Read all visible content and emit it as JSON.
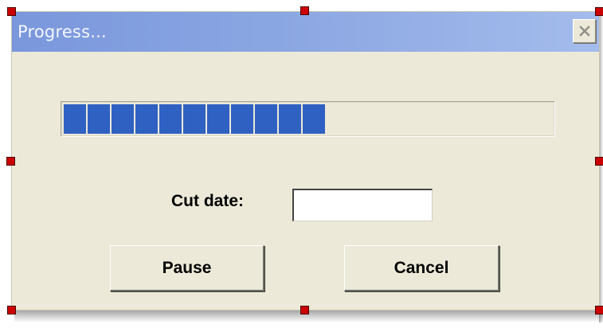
{
  "window": {
    "title": "Progress..."
  },
  "progress": {
    "fraction": 0.53,
    "segments_filled": 11,
    "color": "#2f61c3"
  },
  "cut_date": {
    "label": "Cut date:",
    "value": "",
    "placeholder": ""
  },
  "buttons": {
    "pause_label": "Pause",
    "cancel_label": "Cancel"
  },
  "icons": {
    "close": "close-icon"
  },
  "colors": {
    "titlebar_start": "#7a97dc",
    "titlebar_end": "#a4bcec",
    "dialog_background": "#ece9d8",
    "selection_handle": "#cc0000"
  }
}
